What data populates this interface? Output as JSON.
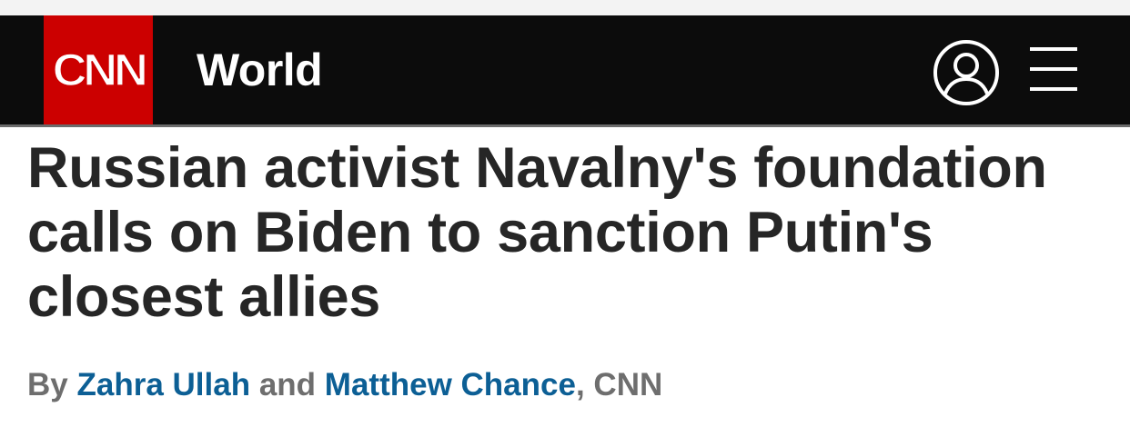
{
  "header": {
    "logo_text": "CNN",
    "section": "World",
    "icons": {
      "account": "user-circle-icon",
      "menu": "hamburger-menu-icon"
    },
    "colors": {
      "background": "#0c0c0c",
      "logo_red": "#cc0000",
      "text": "#ffffff"
    }
  },
  "article": {
    "headline": "Russian activist Navalny's foundation calls on Biden to sanction Putin's closest allies",
    "byline": {
      "prefix": "By",
      "author_1": "Zahra Ullah",
      "conjunction": "and",
      "author_2": "Matthew Chance",
      "separator": ",",
      "source": "CNN"
    },
    "colors": {
      "headline": "#262626",
      "byline": "#6e6e6e",
      "author_link": "#0c5f95"
    }
  }
}
